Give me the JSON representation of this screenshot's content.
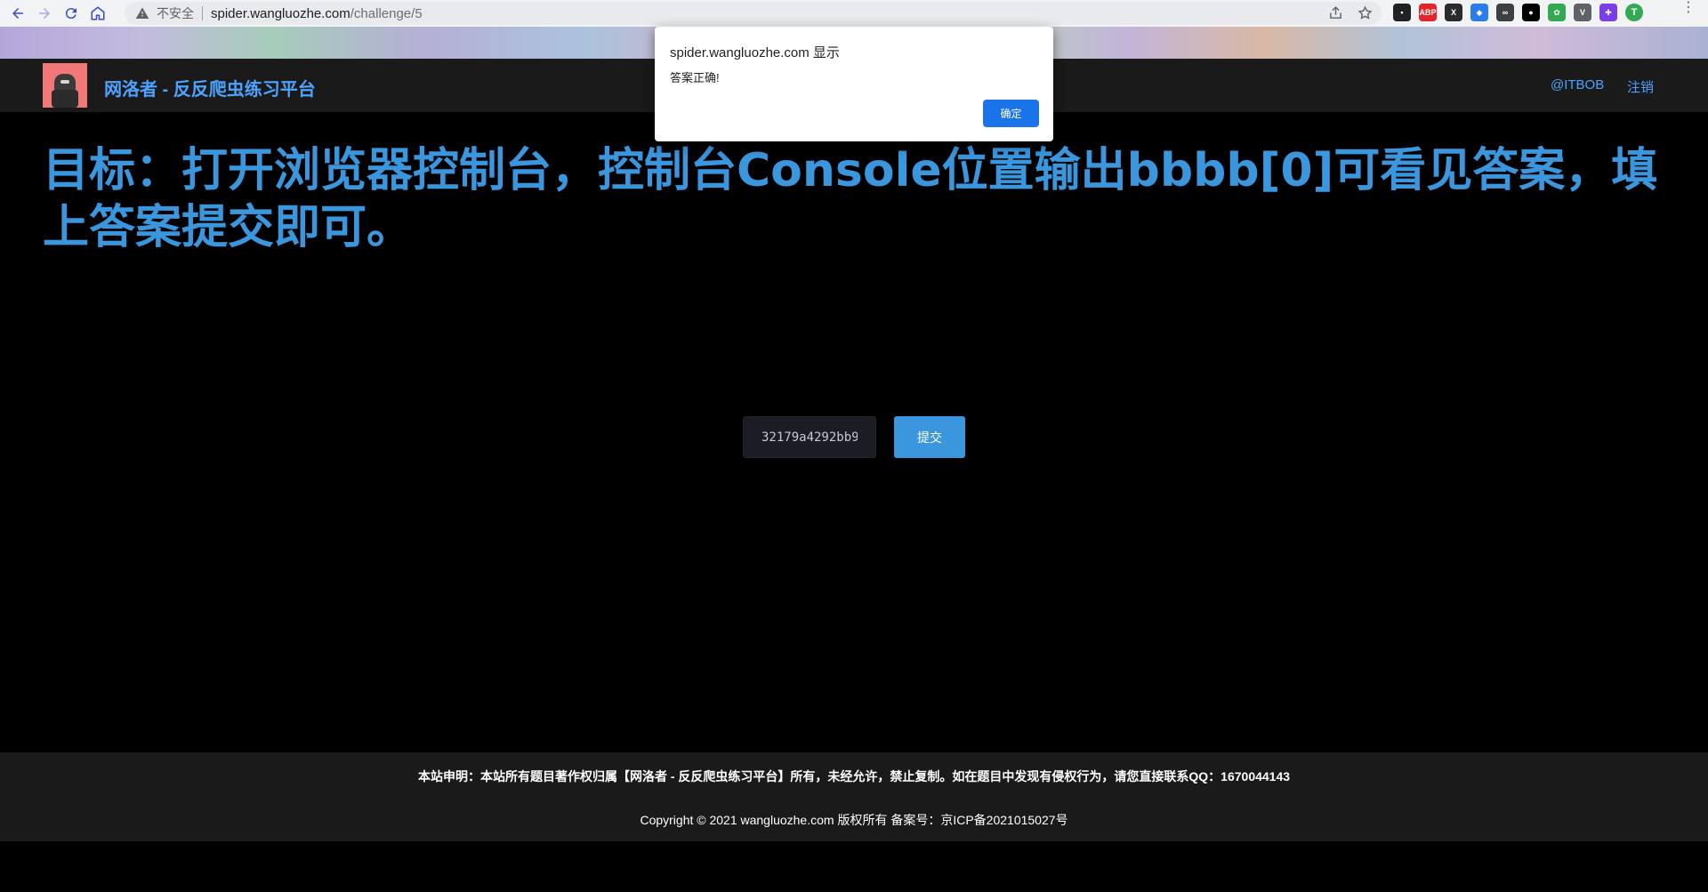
{
  "browser": {
    "security_label": "不安全",
    "url_host": "spider.wangluozhe.com",
    "url_path": "/challenge/5",
    "extensions": [
      {
        "name": "ext-1",
        "label": "▪",
        "color": "#202124"
      },
      {
        "name": "ext-abp",
        "label": "ABP",
        "color": "#e4252c"
      },
      {
        "name": "ext-x",
        "label": "X",
        "color": "#2b2b2b"
      },
      {
        "name": "ext-shield",
        "label": "◆",
        "color": "#2b7de9"
      },
      {
        "name": "ext-link",
        "label": "∞",
        "color": "#3c4043"
      },
      {
        "name": "ext-ring",
        "label": "●",
        "color": "#000000"
      },
      {
        "name": "ext-ai",
        "label": "✿",
        "color": "#34a853"
      },
      {
        "name": "ext-v",
        "label": "V",
        "color": "#5f6368"
      },
      {
        "name": "ext-puzzle",
        "label": "✚",
        "color": "#7b3fe4"
      }
    ],
    "profile_initial": "T"
  },
  "header": {
    "site_title": "网洛者 - 反反爬虫练习平台",
    "user_link": "@ITBOB",
    "logout_link": "注销"
  },
  "main": {
    "goal": "目标：打开浏览器控制台，控制台Console位置输出bbbb[0]可看见答案，填上答案提交即可。",
    "answer_value": "32179a4292bb9",
    "submit_label": "提交"
  },
  "footer": {
    "declaration": "本站申明：本站所有题目著作权归属【网洛者 - 反反爬虫练习平台】所有，未经允许，禁止复制。如在题目中发现有侵权行为，请您直接联系QQ：1670044143",
    "copyright": "Copyright © 2021 wangluozhe.com 版权所有 备案号：京ICP备2021015027号"
  },
  "alert": {
    "origin": "spider.wangluozhe.com 显示",
    "message": "答案正确!",
    "ok_label": "确定"
  }
}
